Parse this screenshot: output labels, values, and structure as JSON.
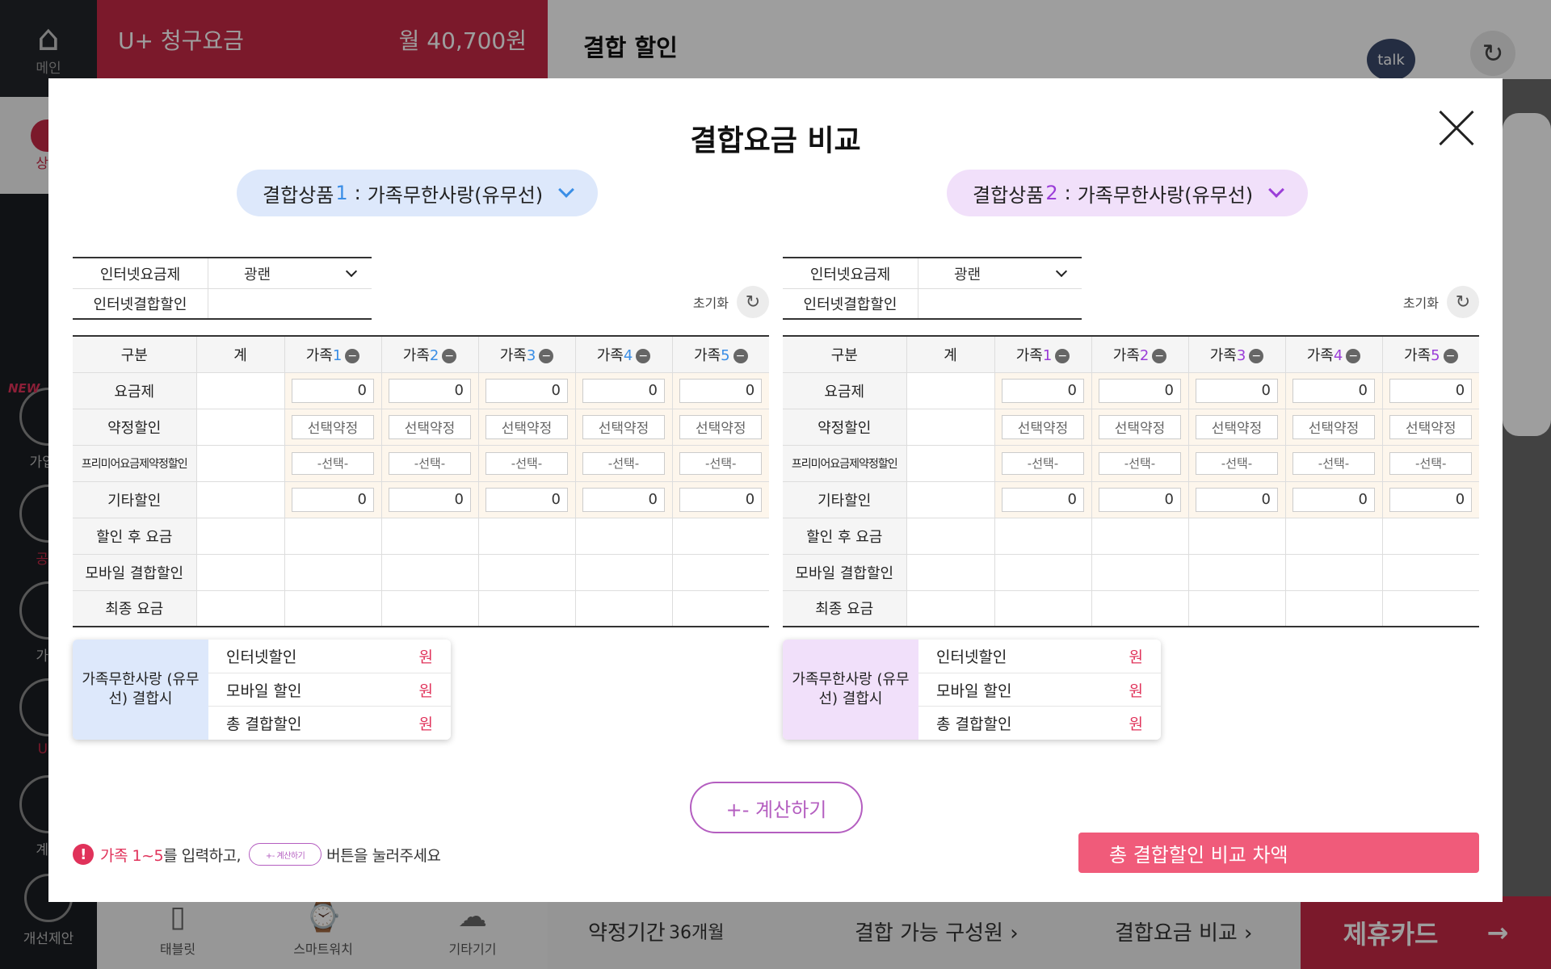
{
  "background": {
    "nav": {
      "home": "메인",
      "consult": "상담",
      "join": "가입정",
      "notice": "공지",
      "guide": "가이",
      "uplus": "U+",
      "calc": "계산",
      "improve": "개선제안",
      "new_badge": "NEW"
    },
    "bill": {
      "label": "U+ 청구요금",
      "amount": "월 40,700원"
    },
    "page_title": "결합 할인",
    "talk": "talk",
    "bottom": {
      "tablet": "태블릿",
      "watch": "스마트워치",
      "other": "기타기기",
      "contract_label": "약정기간",
      "contract_value": "36개월",
      "members": "결합 가능 구성원 ›",
      "compare": "결합요금 비교 ›",
      "partner_card": "제휴카드",
      "partner_arrow": "→"
    }
  },
  "modal": {
    "title": "결합요금 비교",
    "colors": {
      "accent1": "#3a8ee6",
      "accent2": "#9b3ed8",
      "pink": "#e0325a",
      "calc": "#b45ec0"
    },
    "reset_label": "초기화",
    "calc_label": "+- 계산하기",
    "notice": {
      "prefix": "가족 1~5",
      "mid": "를 입력하고,",
      "btn": "+- 계산하기",
      "suffix": "버튼을 눌러주세요"
    },
    "diff_label": "총 결합할인 비교 차액",
    "products": [
      {
        "prefix": "결합상품",
        "num": "1",
        "sep": " :",
        "name": "가족무한사랑(유무선)",
        "mini": {
          "plan_label": "인터넷요금제",
          "plan_value": "광랜",
          "discount_label": "인터넷결합할인",
          "discount_value": ""
        },
        "table": {
          "headers": {
            "category": "구분",
            "total": "계",
            "family": "가족",
            "nums": [
              "1",
              "2",
              "3",
              "4",
              "5"
            ]
          },
          "rows": {
            "plan": "요금제",
            "contract": "약정할인",
            "premium": "프리미어요금제약정할인",
            "other": "기타할인",
            "after": "할인 후 요금",
            "mobile": "모바일 결합할인",
            "final": "최종 요금"
          },
          "plan_values": [
            "0",
            "0",
            "0",
            "0",
            "0"
          ],
          "contract_values": [
            "선택약정",
            "선택약정",
            "선택약정",
            "선택약정",
            "선택약정"
          ],
          "premium_values": [
            "-선택-",
            "-선택-",
            "-선택-",
            "-선택-",
            "-선택-"
          ],
          "other_values": [
            "0",
            "0",
            "0",
            "0",
            "0"
          ]
        },
        "summary": {
          "title": "가족무한사랑 (유무선) 결합시",
          "rows": [
            {
              "label": "인터넷할인",
              "value": "원"
            },
            {
              "label": "모바일 할인",
              "value": "원"
            },
            {
              "label": "총 결합할인",
              "value": "원"
            }
          ]
        }
      },
      {
        "prefix": "결합상품",
        "num": "2",
        "sep": " :",
        "name": "가족무한사랑(유무선)",
        "mini": {
          "plan_label": "인터넷요금제",
          "plan_value": "광랜",
          "discount_label": "인터넷결합할인",
          "discount_value": ""
        },
        "table": {
          "headers": {
            "category": "구분",
            "total": "계",
            "family": "가족",
            "nums": [
              "1",
              "2",
              "3",
              "4",
              "5"
            ]
          },
          "rows": {
            "plan": "요금제",
            "contract": "약정할인",
            "premium": "프리미어요금제약정할인",
            "other": "기타할인",
            "after": "할인 후 요금",
            "mobile": "모바일 결합할인",
            "final": "최종 요금"
          },
          "plan_values": [
            "0",
            "0",
            "0",
            "0",
            "0"
          ],
          "contract_values": [
            "선택약정",
            "선택약정",
            "선택약정",
            "선택약정",
            "선택약정"
          ],
          "premium_values": [
            "-선택-",
            "-선택-",
            "-선택-",
            "-선택-",
            "-선택-"
          ],
          "other_values": [
            "0",
            "0",
            "0",
            "0",
            "0"
          ]
        },
        "summary": {
          "title": "가족무한사랑 (유무선) 결합시",
          "rows": [
            {
              "label": "인터넷할인",
              "value": "원"
            },
            {
              "label": "모바일 할인",
              "value": "원"
            },
            {
              "label": "총 결합할인",
              "value": "원"
            }
          ]
        }
      }
    ]
  }
}
